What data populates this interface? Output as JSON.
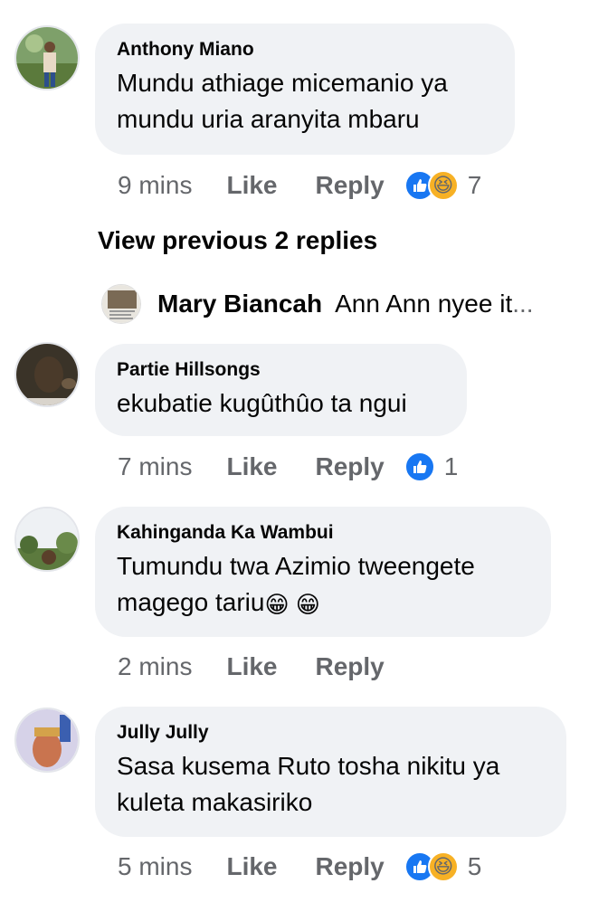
{
  "comments": [
    {
      "author": "Anthony Miano",
      "text": "Mundu athiage micemanio ya mundu uria aranyita mbaru",
      "time": "9 mins",
      "like": "Like",
      "reply": "Reply",
      "reactions": [
        "like",
        "haha"
      ],
      "reaction_count": "7"
    },
    {
      "author": "Partie Hillsongs",
      "text": "ekubatie kugûthûo ta ngui",
      "time": "7 mins",
      "like": "Like",
      "reply": "Reply",
      "reactions": [
        "like"
      ],
      "reaction_count": "1"
    },
    {
      "author": "Kahinganda Ka Wambui",
      "text": "Tumundu twa Azimio tweengete magego tariu",
      "emoji": "😁 😁",
      "time": "2 mins",
      "like": "Like",
      "reply": "Reply"
    },
    {
      "author": "Jully Jully",
      "text": "Sasa kusema Ruto tosha nikitu ya kuleta makasiriko",
      "time": "5 mins",
      "like": "Like",
      "reply": "Reply",
      "reactions": [
        "like",
        "haha"
      ],
      "reaction_count": "5"
    }
  ],
  "view_previous": "View previous 2 replies",
  "reply_preview": {
    "author": "Mary Biancah",
    "text": "Ann Ann nyee it",
    "ellipsis": "..."
  },
  "colors": {
    "bubble": "#f0f2f5",
    "meta_text": "#65676b",
    "like_blue": "#1877f2",
    "haha_yellow": "#f7b125"
  }
}
